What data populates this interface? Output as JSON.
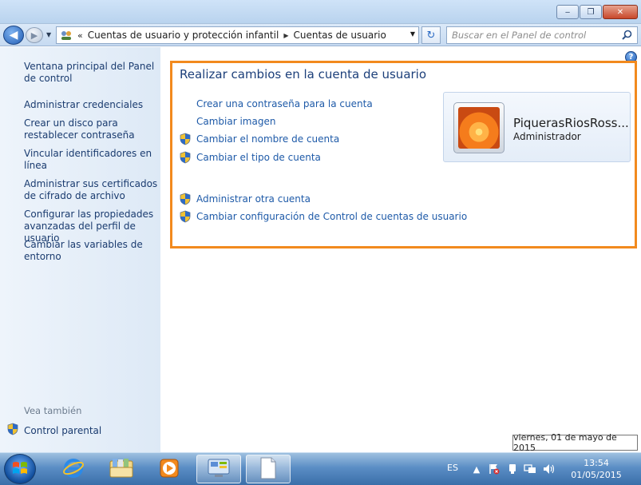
{
  "window": {
    "controls": {
      "minimize": "‒",
      "maximize": "❐",
      "close": "✕"
    }
  },
  "nav": {
    "breadcrumb_prefix": "«",
    "breadcrumbs": [
      "Cuentas de usuario y protección infantil",
      "Cuentas de usuario"
    ],
    "search_placeholder": "Buscar en el Panel de control"
  },
  "sidebar": {
    "links": [
      "Ventana principal del Panel de control",
      "Administrar credenciales",
      "Crear un disco para restablecer contraseña",
      "Vincular identificadores en línea",
      "Administrar sus certificados de cifrado de archivo",
      "Configurar las propiedades avanzadas del perfil de usuario",
      "Cambiar las variables de entorno"
    ],
    "see_also_title": "Vea también",
    "see_also_link": "Control parental"
  },
  "main": {
    "heading": "Realizar cambios en la cuenta de usuario",
    "tasks": [
      {
        "label": "Crear una contraseña para la cuenta",
        "shield": false
      },
      {
        "label": "Cambiar imagen",
        "shield": false
      },
      {
        "label": "Cambiar el nombre de cuenta",
        "shield": true
      },
      {
        "label": "Cambiar el tipo de cuenta",
        "shield": true
      },
      {
        "label": "Administrar otra cuenta",
        "shield": true
      },
      {
        "label": "Cambiar configuración de Control de cuentas de usuario",
        "shield": true
      }
    ],
    "help": "?",
    "user": {
      "name": "PiquerasRiosRoss...",
      "role": "Administrador"
    },
    "highlight_color": "#f28a1e"
  },
  "tooltip": "viernes, 01 de mayo de 2015",
  "taskbar": {
    "language": "ES",
    "time": "13:54",
    "date": "01/05/2015",
    "apps": [
      "internet-explorer-icon",
      "library-folder-icon",
      "media-player-icon",
      "control-panel-icon",
      "notepad-document-icon"
    ]
  }
}
